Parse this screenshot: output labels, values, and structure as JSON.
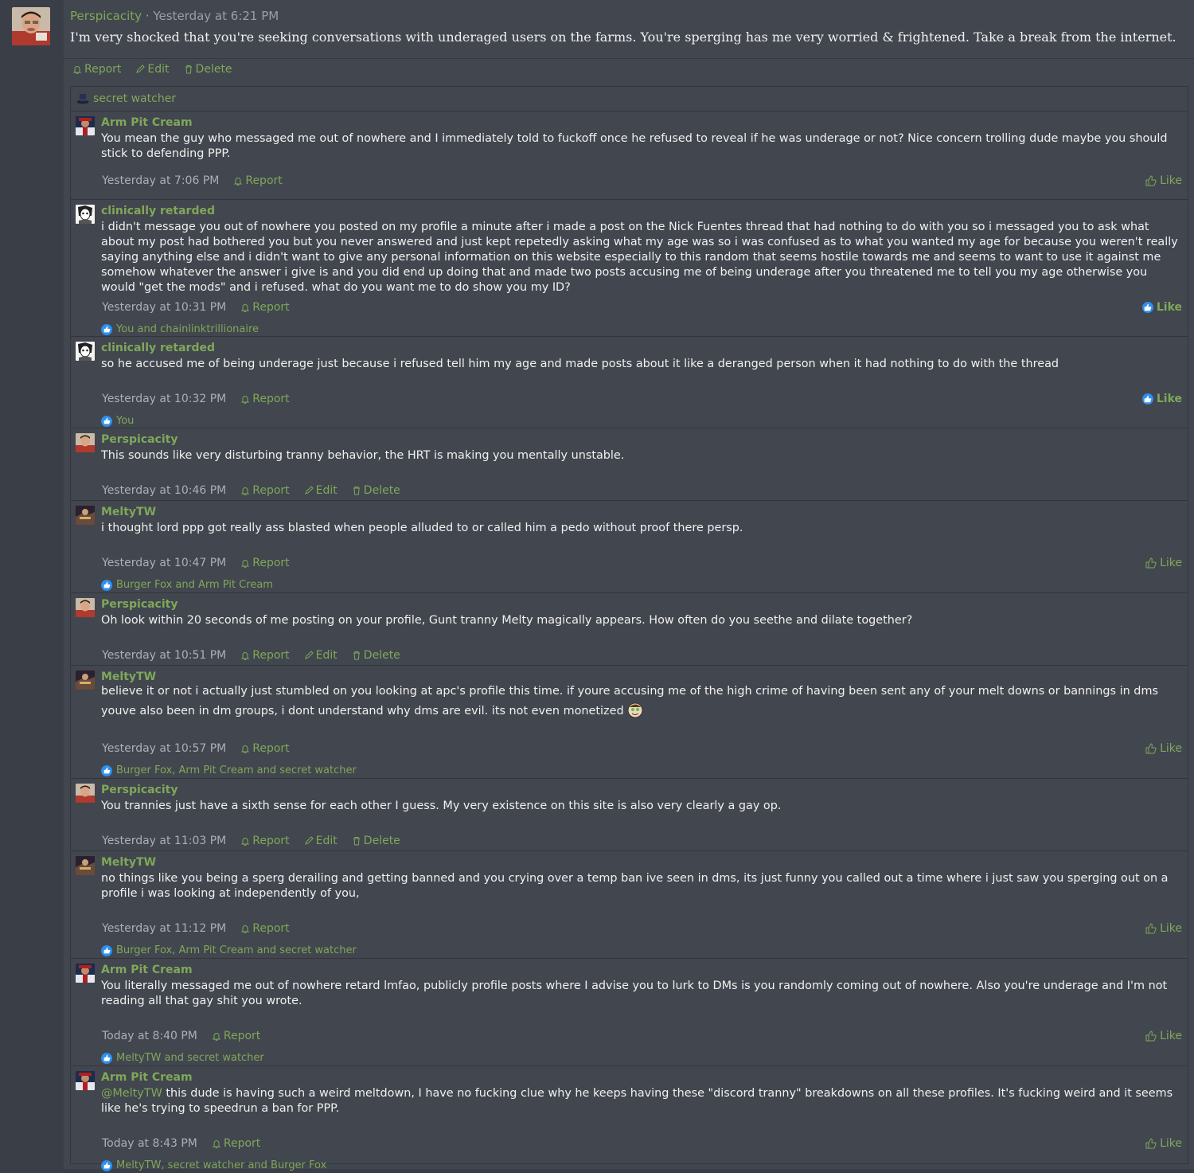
{
  "post": {
    "username": "Perspicacity",
    "separator": " · ",
    "timestamp": "Yesterday at 6:21 PM",
    "text": "I'm very shocked that you're seeking conversations with underaged users on the farms. You're sperging has me very worried & frightened. Take a break from the internet.",
    "actions": {
      "report": "Report",
      "edit": "Edit",
      "delete": "Delete"
    }
  },
  "secret_row": {
    "label": "secret watcher",
    "icon": "top-hat-icon"
  },
  "labels": {
    "report": "Report",
    "edit": "Edit",
    "delete": "Delete",
    "like": "Like"
  },
  "colors": {
    "accent": "#7fa85a",
    "like_badge": "#2d8ff0",
    "background": "#42464e"
  },
  "comments": [
    {
      "author": "Arm Pit Cream",
      "text": "You mean the guy who messaged me out of nowhere and I immediately told to fuckoff once he refused to reveal if he was underage or not? Nice concern trolling dude maybe you should stick to defending PPP.",
      "time": "Yesterday at 7:06 PM",
      "likers": ""
    },
    {
      "author": "clinically retarded",
      "text": "i didn't message you out of nowhere you posted on my profile a minute after i made a post on the Nick Fuentes thread that had nothing to do with you so i messaged you to ask what about my post had bothered you but you never answered and just kept repetedly asking what my age was so i was confused as to what you wanted my age for because you weren't really saying anything else and i didn't want to give any personal information on this website especially to this random that seems hostile towards me and seems to want to use it against me somehow whatever the answer i give is and you did end up doing that and made two posts accusing me of being underage after you threatened me to tell you my age otherwise you would \"get the mods\" and i refused. what do you want me to do show you my ID?",
      "time": "Yesterday at 10:31 PM",
      "likers": "You and chainlinktrillionaire"
    },
    {
      "author": "clinically retarded",
      "text": "so he accused me of being underage just because i refused tell him my age and made posts about it like a deranged person when it had nothing to do with the thread",
      "time": "Yesterday at 10:32 PM",
      "likers": "You"
    },
    {
      "author": "Perspicacity",
      "text": "This sounds like very disturbing tranny behavior, the HRT is making you mentally unstable.",
      "time": "Yesterday at 10:46 PM",
      "likers": ""
    },
    {
      "author": "MeltyTW",
      "text": "i thought lord ppp got really ass blasted when people alluded to or called him a pedo without proof there persp.",
      "time": "Yesterday at 10:47 PM",
      "likers": "Burger Fox and Arm Pit Cream"
    },
    {
      "author": "Perspicacity",
      "text": "Oh look within 20 seconds of me posting on your profile, Gunt tranny Melty magically appears. How often do you seethe and dilate together?",
      "time": "Yesterday at 10:51 PM",
      "likers": ""
    },
    {
      "author": "MeltyTW",
      "text": "believe it or not i actually just stumbled on you looking at apc's profile this time. if youre accusing me of the high crime of having been sent any of your melt downs or bannings in dms youve also been in dm groups, i dont understand why dms are evil. its not even monetized",
      "time": "Yesterday at 10:57 PM",
      "likers": "Burger Fox, Arm Pit Cream and secret watcher"
    },
    {
      "author": "Perspicacity",
      "text": "You trannies just have a sixth sense for each other I guess. My very existence on this site is also very clearly a gay op.",
      "time": "Yesterday at 11:03 PM",
      "likers": ""
    },
    {
      "author": "MeltyTW",
      "text": "no things like you being a sperg derailing and getting banned and you crying over a temp ban ive seen in dms, its just funny you called out a time where i just saw you sperging out on a profile i was looking at independently of you,",
      "time": "Yesterday at 11:12 PM",
      "likers": "Burger Fox, Arm Pit Cream and secret watcher"
    },
    {
      "author": "Arm Pit Cream",
      "text": "You literally messaged me out of nowhere retard lmfao, publicly profile posts where I advise you to lurk to DMs is you randomly coming out of nowhere. Also you're underage and I'm not reading all that gay shit you wrote.",
      "time": "Today at 8:40 PM",
      "likers": "MeltyTW and secret watcher"
    },
    {
      "author": "Arm Pit Cream",
      "mention": "@MeltyTW",
      "text": " this dude is having such a weird meltdown, I have no fucking clue why he keeps having these \"discord tranny\" breakdowns on all these profiles. It's fucking weird and it seems like he's trying to speedrun a ban for PPP.",
      "time": "Today at 8:43 PM",
      "likers": "MeltyTW, secret watcher and Burger Fox"
    }
  ]
}
